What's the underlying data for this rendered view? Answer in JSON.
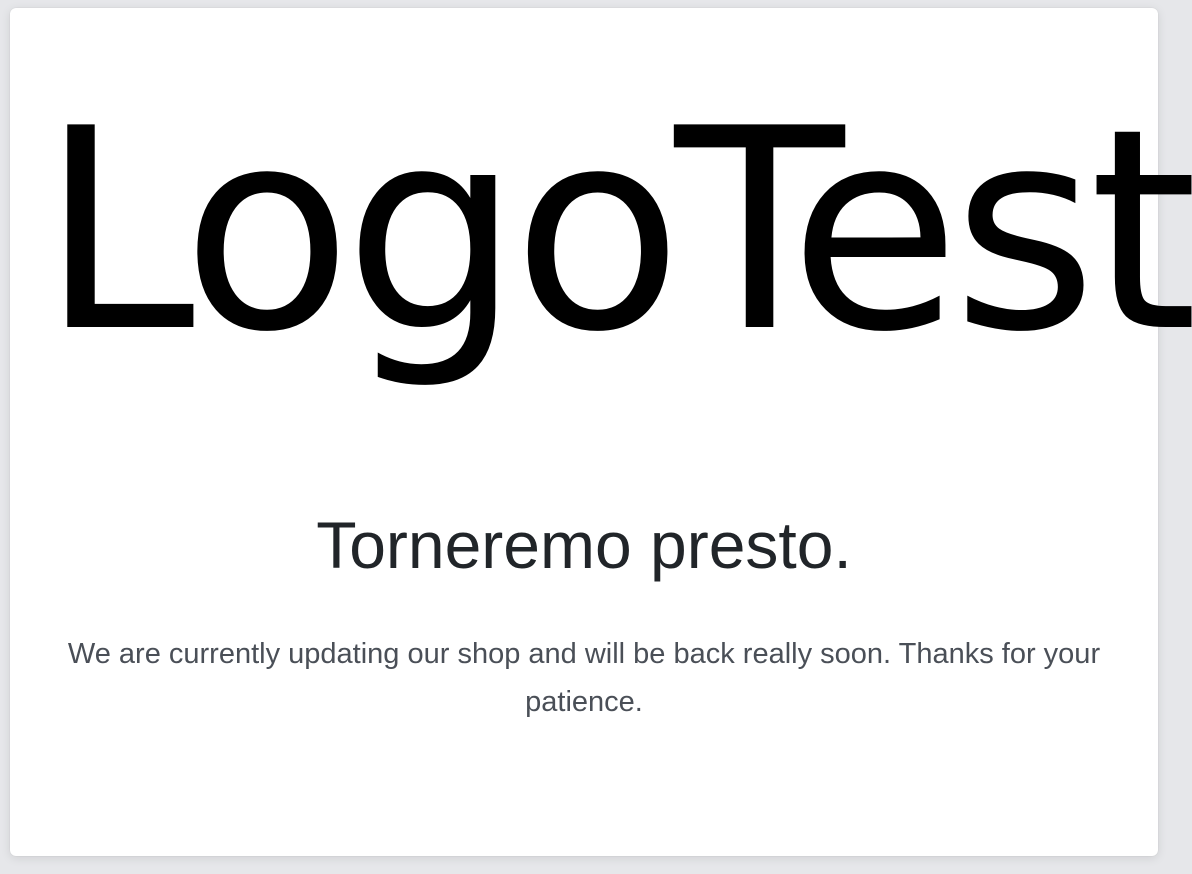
{
  "logo": {
    "text": "LogoTest"
  },
  "maintenance": {
    "title": "Torneremo presto.",
    "message": "We are currently updating our shop and will be back really soon. Thanks for your patience."
  },
  "colors": {
    "page_background": "#e6e7ea",
    "card_background": "#ffffff",
    "logo_text": "#000000",
    "title_text": "#212529",
    "message_text": "#4a4f57"
  }
}
